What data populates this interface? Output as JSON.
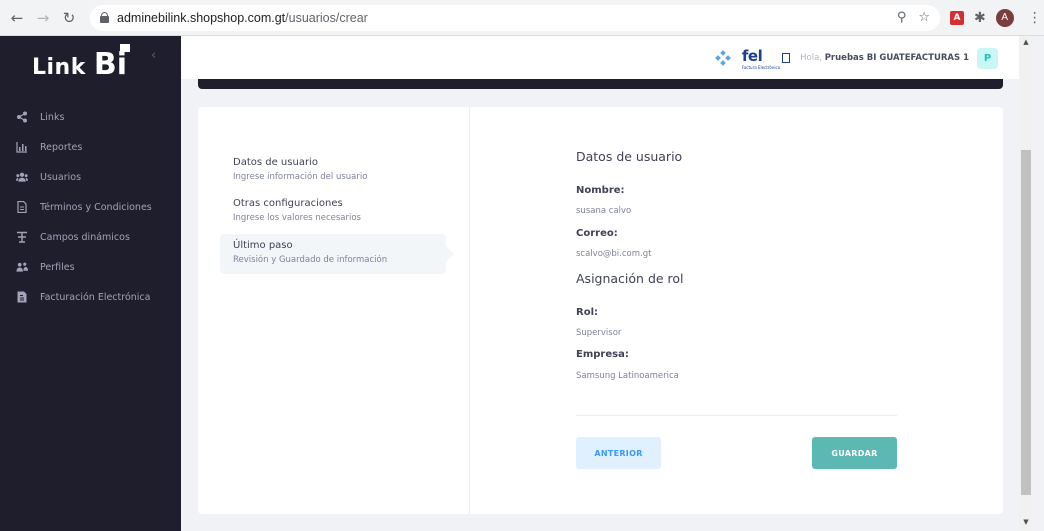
{
  "browser": {
    "url_host": "adminebilink.shopshop.com.gt",
    "url_path": "/usuarios/crear",
    "profile_initial": "A",
    "pdf_ext_label": "A"
  },
  "sidebar": {
    "logo_text": "Link",
    "logo_bi": "Bi",
    "items": [
      {
        "label": "Links",
        "icon": "share-icon"
      },
      {
        "label": "Reportes",
        "icon": "chart-icon"
      },
      {
        "label": "Usuarios",
        "icon": "users-icon"
      },
      {
        "label": "Términos y Condiciones",
        "icon": "document-icon"
      },
      {
        "label": "Campos dinámicos",
        "icon": "fields-icon"
      },
      {
        "label": "Perfiles",
        "icon": "profiles-icon"
      },
      {
        "label": "Facturación Electrónica",
        "icon": "invoice-icon"
      }
    ]
  },
  "header": {
    "fel_logo": "fel",
    "fel_sub": "Factura Electrónica",
    "greeting": "Hola,",
    "user_name": "Pruebas BI GUATEFACTURAS 1",
    "avatar_initial": "P"
  },
  "wizard": {
    "steps": [
      {
        "title": "Datos de usuario",
        "desc": "Ingrese información del usuario"
      },
      {
        "title": "Otras configuraciones",
        "desc": "Ingrese los valores necesarios"
      },
      {
        "title": "Último paso",
        "desc": "Revisión y Guardado de información"
      }
    ],
    "review": {
      "section_user": "Datos de usuario",
      "name_label": "Nombre:",
      "name_value": "susana calvo",
      "email_label": "Correo:",
      "email_value": "scalvo@bi.com.gt",
      "section_role": "Asignación de rol",
      "role_label": "Rol:",
      "role_value": "Supervisor",
      "company_label": "Empresa:",
      "company_value": "Samsung Latinoamerica"
    },
    "buttons": {
      "prev": "ANTERIOR",
      "save": "GUARDAR"
    }
  },
  "colors": {
    "sidebar_bg": "#1e1e2d",
    "save_button": "#5cb8b2",
    "prev_button_bg": "#e1f0ff",
    "prev_button_text": "#3699ff"
  }
}
